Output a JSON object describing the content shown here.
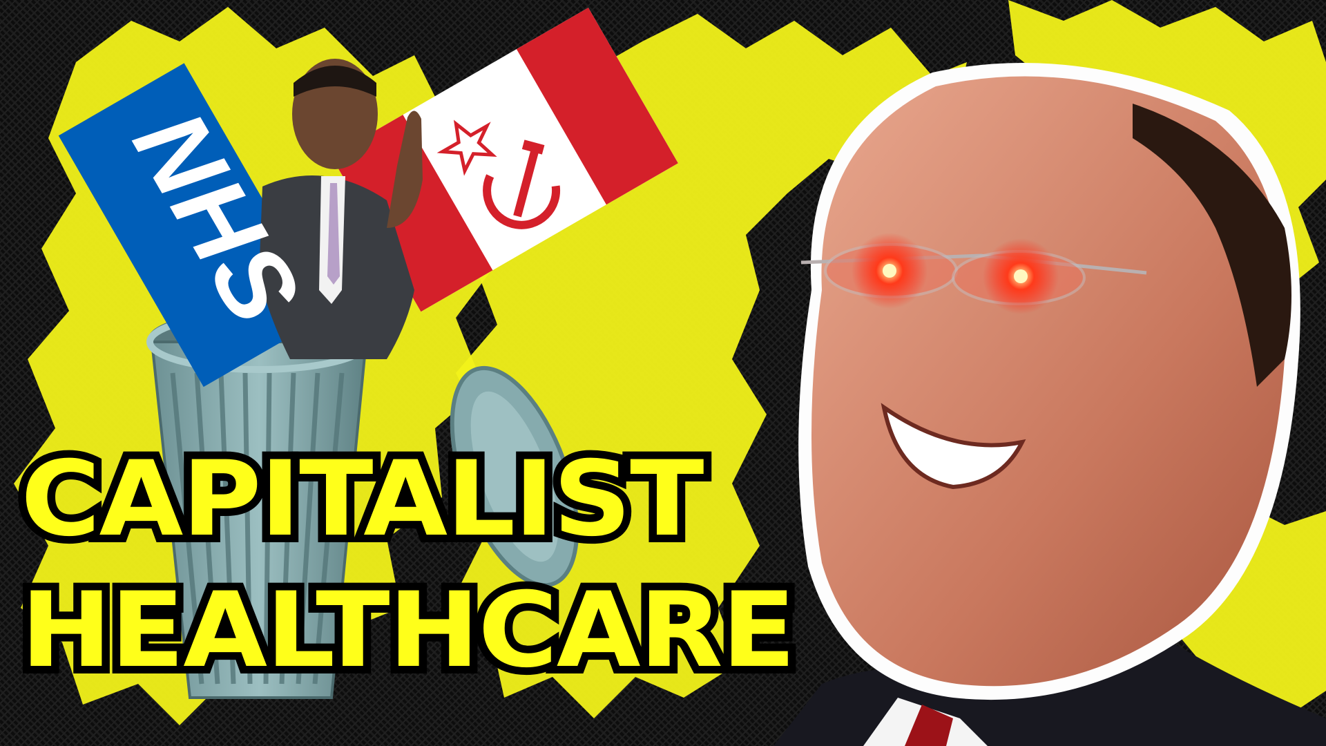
{
  "title": {
    "line1": "CAPITALIST",
    "line2": "HEALTHCARE"
  },
  "logo": {
    "text": "NHS"
  },
  "icons": {
    "flag": "hammer-sickle-flag-icon",
    "trash": "trash-can-icon",
    "lid": "trash-lid-icon"
  },
  "colors": {
    "accent_yellow": "#ffff1a",
    "nhs_blue": "#005eb8",
    "flag_red": "#d4202a",
    "trash_teal": "#7fa3a6",
    "eye_glow": "#ff2a1a",
    "background": "#111111"
  }
}
